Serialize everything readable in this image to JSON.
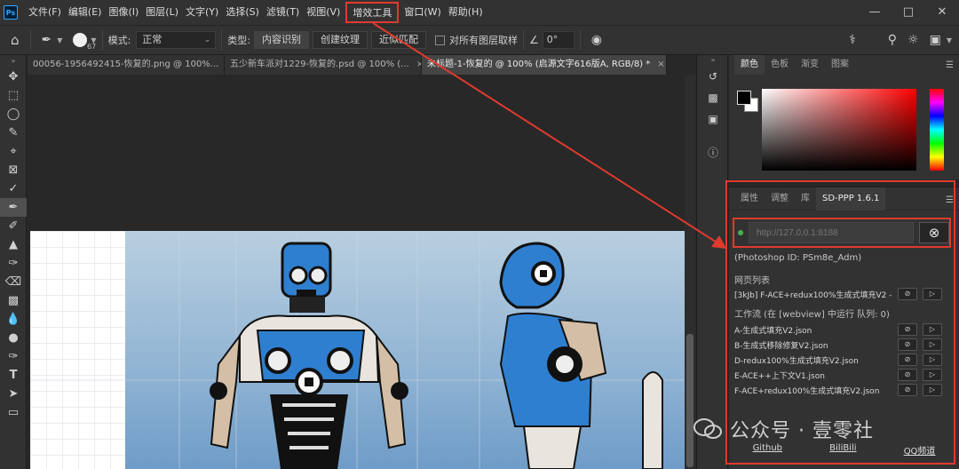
{
  "app": {
    "logo": "Ps"
  },
  "menu": [
    "文件(F)",
    "编辑(E)",
    "图像(I)",
    "图层(L)",
    "文字(Y)",
    "选择(S)",
    "滤镜(T)",
    "视图(V)",
    "增效工具",
    "窗口(W)",
    "帮助(H)"
  ],
  "options": {
    "brush_size": "67",
    "mode_label": "模式:",
    "mode_value": "正常",
    "type_label": "类型:",
    "type_options": [
      "内容识别",
      "创建纹理",
      "近似匹配"
    ],
    "sample_all_label": "对所有图层取样",
    "angle": "0°"
  },
  "doc_tabs": [
    {
      "label": "00056-1956492415-恢复的.png @ 100%...",
      "close": "×"
    },
    {
      "label": "五少新车派对1229-恢复的.psd @ 100% (...",
      "close": "×"
    },
    {
      "label": "未标题-1-恢复的 @ 100% (启源文字616版A, RGB/8) *",
      "close": "×"
    }
  ],
  "color_panel": {
    "tabs": [
      "颜色",
      "色板",
      "渐变",
      "图案"
    ],
    "active_tab": "颜色"
  },
  "sd_panel": {
    "tabs": [
      "属性",
      "调整",
      "库",
      "SD-PPP 1.6.1"
    ],
    "active_tab": "SD-PPP 1.6.1",
    "url_placeholder": "http://127.0.0.1:8188",
    "photoshop_id": "(Photoshop ID: PSm8e_Adm)",
    "webpage_list_label": "网页列表",
    "webpage_items": [
      "[3kJb] F-ACE+redux100%生成式填充V2 - C"
    ],
    "workflow_label": "工作流 (在 [webview] 中运行 队列: 0)",
    "workflows": [
      "A-生成式填充V2.json",
      "B-生成式移除修复V2.json",
      "D-redux100%生成式填充V2.json",
      "E-ACE++上下文V1.json",
      "F-ACE+redux100%生成式填充V2.json"
    ],
    "links": [
      "Github",
      "BiliBili",
      "QQ频道"
    ]
  },
  "watermark": "公众号 · 壹零社",
  "colors": {
    "highlight": "#e03a2e",
    "panel": "#323232",
    "status_ok": "#4caf50"
  }
}
